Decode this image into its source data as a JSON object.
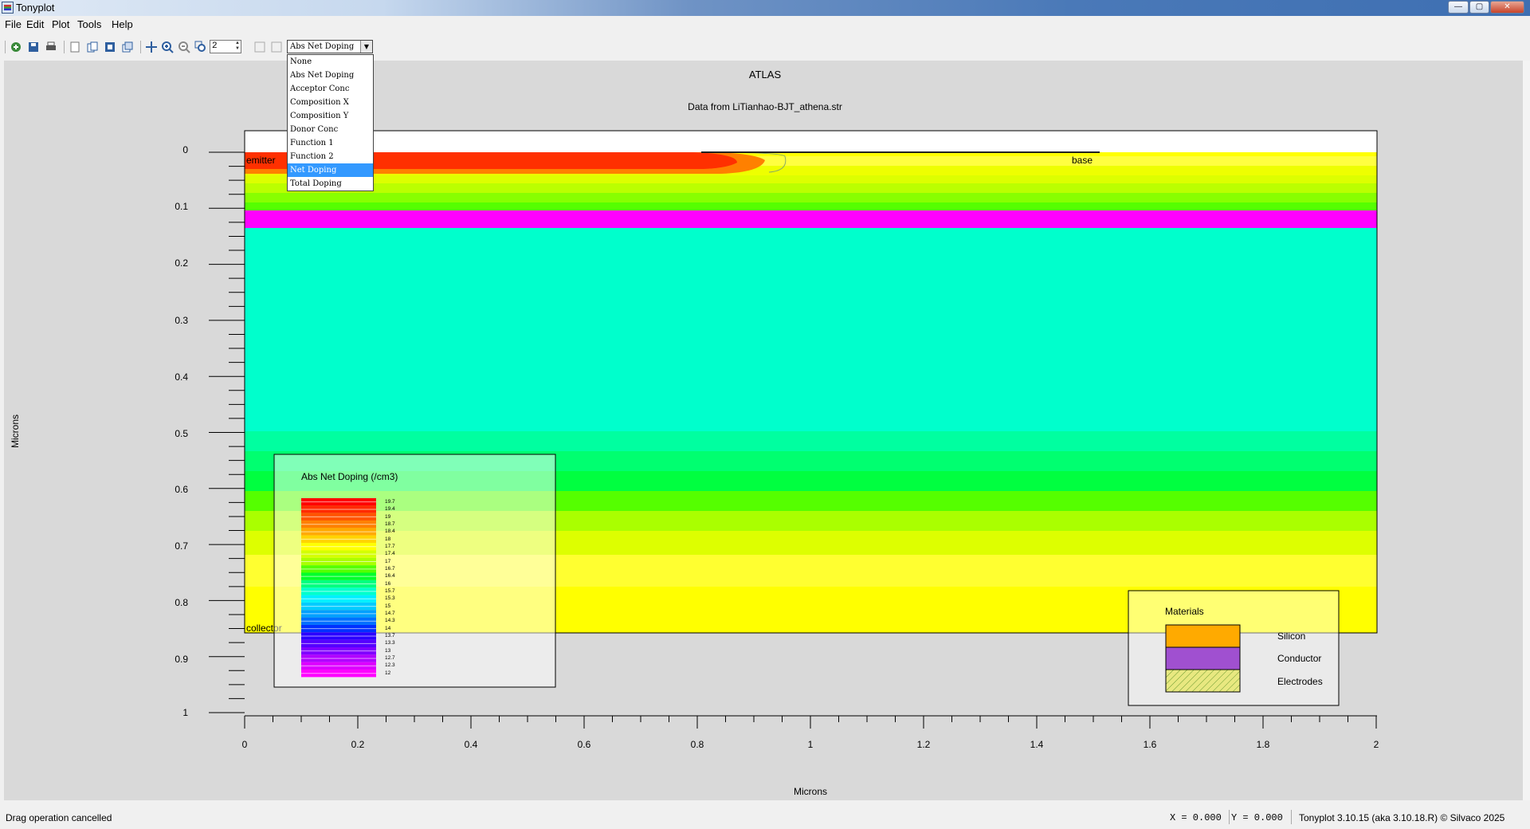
{
  "window": {
    "title": "Tonyplot"
  },
  "menu": [
    "File",
    "Edit",
    "Plot",
    "Tools",
    "Help"
  ],
  "toolbar": {
    "zoom_value": "2",
    "selected_quantity": "Abs Net Doping"
  },
  "dropdown": {
    "options": [
      "None",
      "Abs Net Doping",
      "Acceptor Conc",
      "Composition X",
      "Composition Y",
      "Donor Conc",
      "Function 1",
      "Function 2",
      "Net Doping",
      "Total Doping"
    ],
    "highlighted": "Net Doping"
  },
  "plot": {
    "title": "ATLAS",
    "subtitle": "Data from LiTianhao-BJT_athena.str",
    "xlabel": "Microns",
    "ylabel": "Microns",
    "xticks": [
      "0",
      "0.2",
      "0.4",
      "0.6",
      "0.8",
      "1",
      "1.2",
      "1.4",
      "1.6",
      "1.8",
      "2"
    ],
    "yticks": [
      "0",
      "0.1",
      "0.2",
      "0.3",
      "0.4",
      "0.5",
      "0.6",
      "0.7",
      "0.8",
      "0.9",
      "1"
    ],
    "electrodes": [
      "emitter",
      "base",
      "collector"
    ]
  },
  "doping_legend": {
    "title": "Abs Net Doping (/cm3)",
    "values": [
      "19.7",
      "19.4",
      "19",
      "18.7",
      "18.4",
      "18",
      "17.7",
      "17.4",
      "17",
      "16.7",
      "16.4",
      "16",
      "15.7",
      "15.3",
      "15",
      "14.7",
      "14.3",
      "14",
      "13.7",
      "13.3",
      "13",
      "12.7",
      "12.3",
      "12"
    ],
    "colors": [
      "#ff0000",
      "#ff2a00",
      "#ff5500",
      "#ff8000",
      "#ffaa00",
      "#ffd400",
      "#ffff00",
      "#d4ff00",
      "#aaff00",
      "#55ff00",
      "#00ff2a",
      "#00ff80",
      "#00ffcc",
      "#00f0ff",
      "#00ccff",
      "#00a0ff",
      "#0070ff",
      "#0030ff",
      "#2a00ff",
      "#5500ff",
      "#8000ff",
      "#b000ff",
      "#dd00ff",
      "#ff00ff"
    ]
  },
  "materials_legend": {
    "title": "Materials",
    "items": [
      {
        "label": "Silicon",
        "color": "#ffaa00"
      },
      {
        "label": "Conductor",
        "color": "#a050d0"
      },
      {
        "label": "Electrodes",
        "color": "#e8e880"
      }
    ]
  },
  "status": {
    "message": "Drag operation cancelled",
    "x_readout": "X = 0.000",
    "y_readout": "Y = 0.000",
    "version": "Tonyplot 3.10.15 (aka 3.10.18.R) © Silvaco 2025"
  }
}
